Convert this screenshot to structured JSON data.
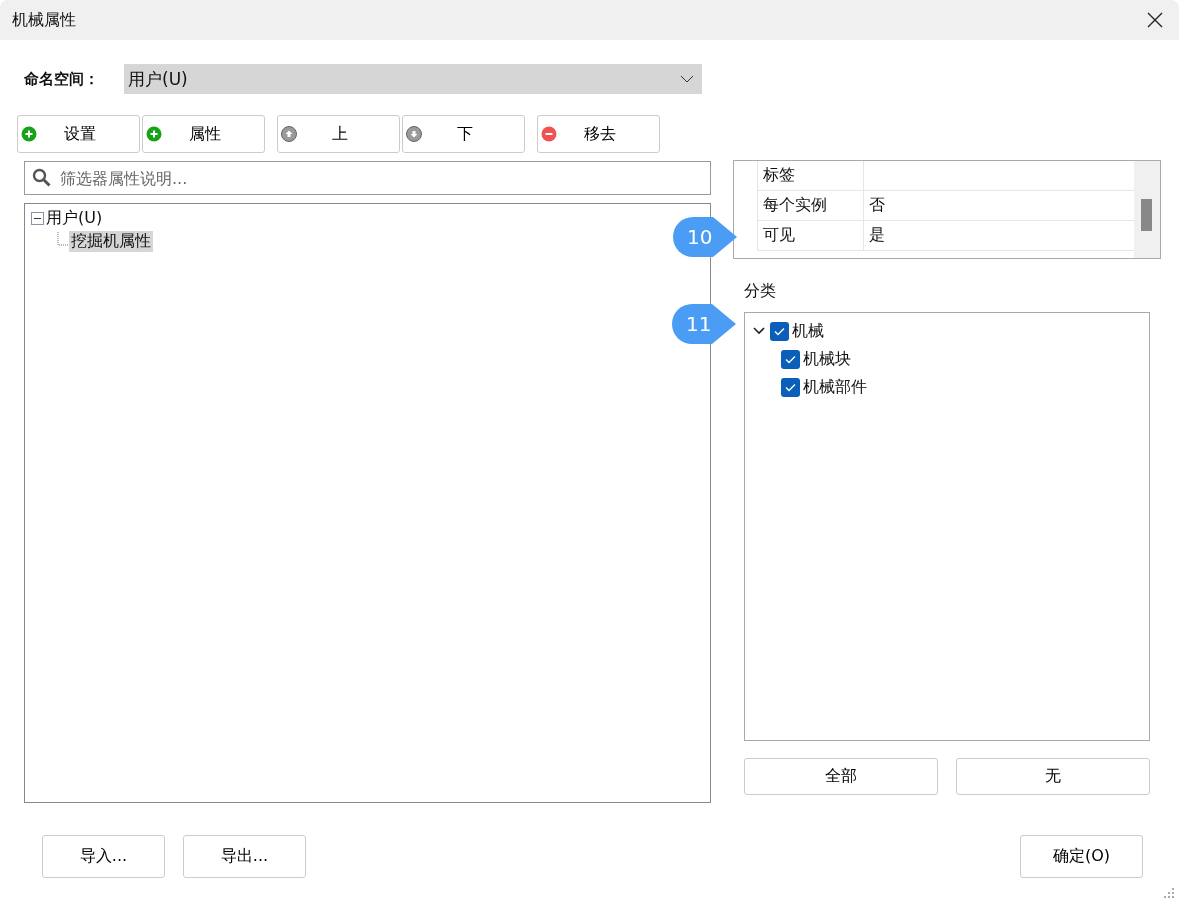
{
  "window": {
    "title": "机械属性"
  },
  "namespace": {
    "label": "命名空间：",
    "value": "用户(U)"
  },
  "toolbar": [
    {
      "label": "设置",
      "kind": "add"
    },
    {
      "label": "属性",
      "kind": "add"
    },
    {
      "label": "上",
      "kind": "up"
    },
    {
      "label": "下",
      "kind": "down"
    },
    {
      "label": "移去",
      "kind": "remove"
    }
  ],
  "search": {
    "placeholder": "筛选器属性说明..."
  },
  "tree": [
    {
      "label": "用户(U)",
      "expanded": true,
      "selected": false,
      "children": [
        {
          "label": "挖掘机属性",
          "selected": true
        }
      ]
    }
  ],
  "properties": {
    "callout": "10",
    "rows": [
      {
        "name": "标签"
      },
      {
        "name": "每个实例",
        "value": "否"
      },
      {
        "name": "可见",
        "value": "是"
      }
    ]
  },
  "categories": {
    "label": "分类",
    "callout": "11",
    "items": [
      {
        "label": "机械",
        "checked": true,
        "expanded": true,
        "children": [
          {
            "label": "机械块",
            "checked": true
          },
          {
            "label": "机械部件",
            "checked": true
          }
        ]
      }
    ]
  },
  "category_buttons": [
    "全部",
    "无"
  ],
  "footer": {
    "left_buttons": [
      "导入...",
      "导出..."
    ],
    "ok_button": "确定(O)"
  }
}
